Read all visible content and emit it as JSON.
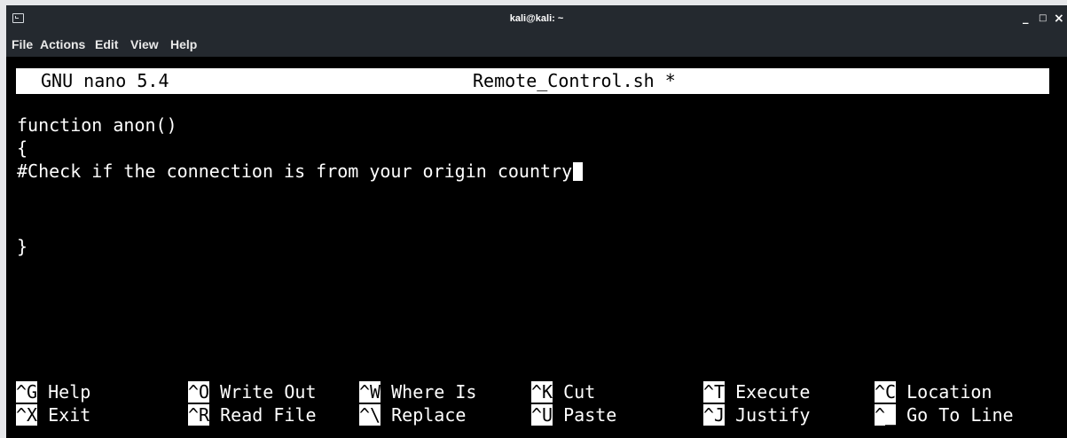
{
  "window": {
    "title": "kali@kali: ~",
    "controls": {
      "minimize": "_",
      "maximize": "□",
      "close": "×"
    }
  },
  "menubar": {
    "items": [
      "File",
      "Actions",
      "Edit",
      "View",
      "Help"
    ]
  },
  "nano": {
    "version": "GNU nano 5.4",
    "filename": "Remote_Control.sh *",
    "buffer": [
      "function anon()",
      "{",
      "#Check if the connection is from your origin country",
      "}"
    ],
    "shortcuts_row1": [
      {
        "key": "^G",
        "label": "Help"
      },
      {
        "key": "^O",
        "label": "Write Out"
      },
      {
        "key": "^W",
        "label": "Where Is"
      },
      {
        "key": "^K",
        "label": "Cut"
      },
      {
        "key": "^T",
        "label": "Execute"
      },
      {
        "key": "^C",
        "label": "Location"
      }
    ],
    "shortcuts_row2": [
      {
        "key": "^X",
        "label": "Exit"
      },
      {
        "key": "^R",
        "label": "Read File"
      },
      {
        "key": "^\\",
        "label": "Replace"
      },
      {
        "key": "^U",
        "label": "Paste"
      },
      {
        "key": "^J",
        "label": "Justify"
      },
      {
        "key": "^_",
        "label": "Go To Line"
      }
    ]
  },
  "colors": {
    "terminal_bg": "#000000",
    "terminal_fg": "#ffffff",
    "titlebar_bg": "#24292f"
  }
}
